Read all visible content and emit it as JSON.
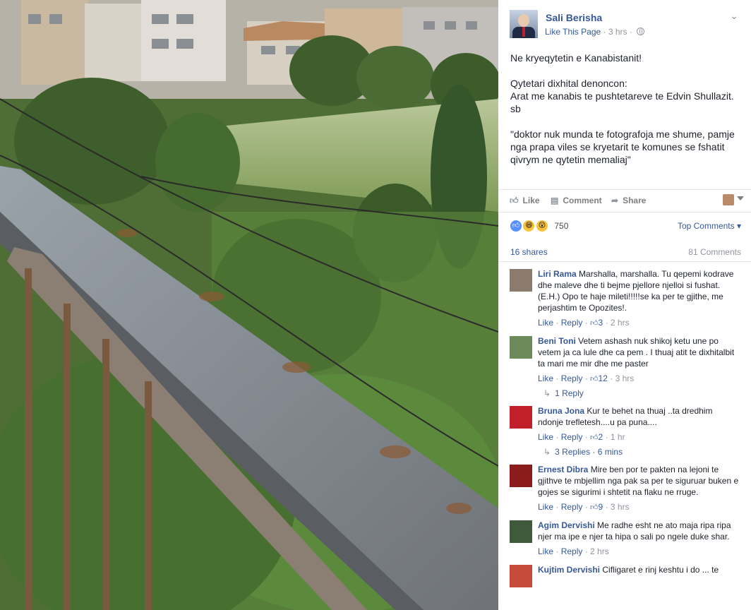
{
  "post": {
    "page_name": "Sali Berisha",
    "like_page": "Like This Page",
    "time": "3 hrs",
    "paragraphs": [
      "Ne kryeqytetin e Kanabistanit!",
      "Qytetari dixhital denoncon:\nArat me kanabis te pushtetareve te Edvin Shullazit.\nsb",
      "\"doktor nuk munda te fotografoja me shume, pamje nga prapa viles se kryetarit te komunes se fshatit qivrym ne qytetin memaliaj\""
    ]
  },
  "actions": {
    "like": "Like",
    "comment": "Comment",
    "share": "Share"
  },
  "reactions": {
    "count": "750"
  },
  "top_comments": "Top Comments",
  "shares": "16 shares",
  "comments_count": "81 Comments",
  "comments": [
    {
      "name": "Liri Rama",
      "text": "Marshalla, marshalla. Tu qepemi kodrave dhe maleve dhe ti bejme pjellore njelloi si fushat. (E.H.) Opo te haje mileti!!!!!se ka per te gjithe, me perjashtim te Opozites!.",
      "like": "Like",
      "reply": "Reply",
      "likes": "3",
      "time": "2 hrs",
      "replies": "",
      "avatar_color": "#8a7b6d"
    },
    {
      "name": "Beni Toni",
      "text": "Vetem ashash nuk shikoj ketu une po vetem ja ca lule dhe ca pem . I thuaj atit te dixhitalbit ta mari me mir dhe me paster",
      "like": "Like",
      "reply": "Reply",
      "likes": "12",
      "time": "3 hrs",
      "replies": "1 Reply",
      "avatar_color": "#6a8a5a"
    },
    {
      "name": "Bruna Jona",
      "text": "Kur te behet na thuaj ..ta dredhim ndonje trefletesh....u pa puna....",
      "like": "Like",
      "reply": "Reply",
      "likes": "2",
      "time": "1 hr",
      "replies": "3 Replies · 6 mins",
      "avatar_color": "#c0202a"
    },
    {
      "name": "Ernest Dibra",
      "text": "Mire ben por te pakten na lejoni te gjithve te mbjellim nga pak sa per te siguruar buken e gojes se sigurimi i shtetit na flaku ne rruge.",
      "like": "Like",
      "reply": "Reply",
      "likes": "9",
      "time": "3 hrs",
      "replies": "",
      "avatar_color": "#8a1c1c"
    },
    {
      "name": "Agim Dervishi",
      "text": "Me radhe esht ne ato maja ripa ripa njer ma ipe e njer ta hipa o sali po ngele duke shar.",
      "like": "Like",
      "reply": "Reply",
      "likes": "",
      "time": "2 hrs",
      "replies": "",
      "avatar_color": "#3e5a3a"
    },
    {
      "name": "Kujtim Dervishi",
      "text": "Cifligaret e rinj keshtu i do ... te",
      "like": "",
      "reply": "",
      "likes": "",
      "time": "",
      "replies": "",
      "avatar_color": "#c84a3a"
    }
  ],
  "icons": [
    "globe-icon",
    "chevron-down-icon",
    "like-icon",
    "comment-icon",
    "share-icon",
    "thumb-icon",
    "reply-arrow-icon"
  ]
}
